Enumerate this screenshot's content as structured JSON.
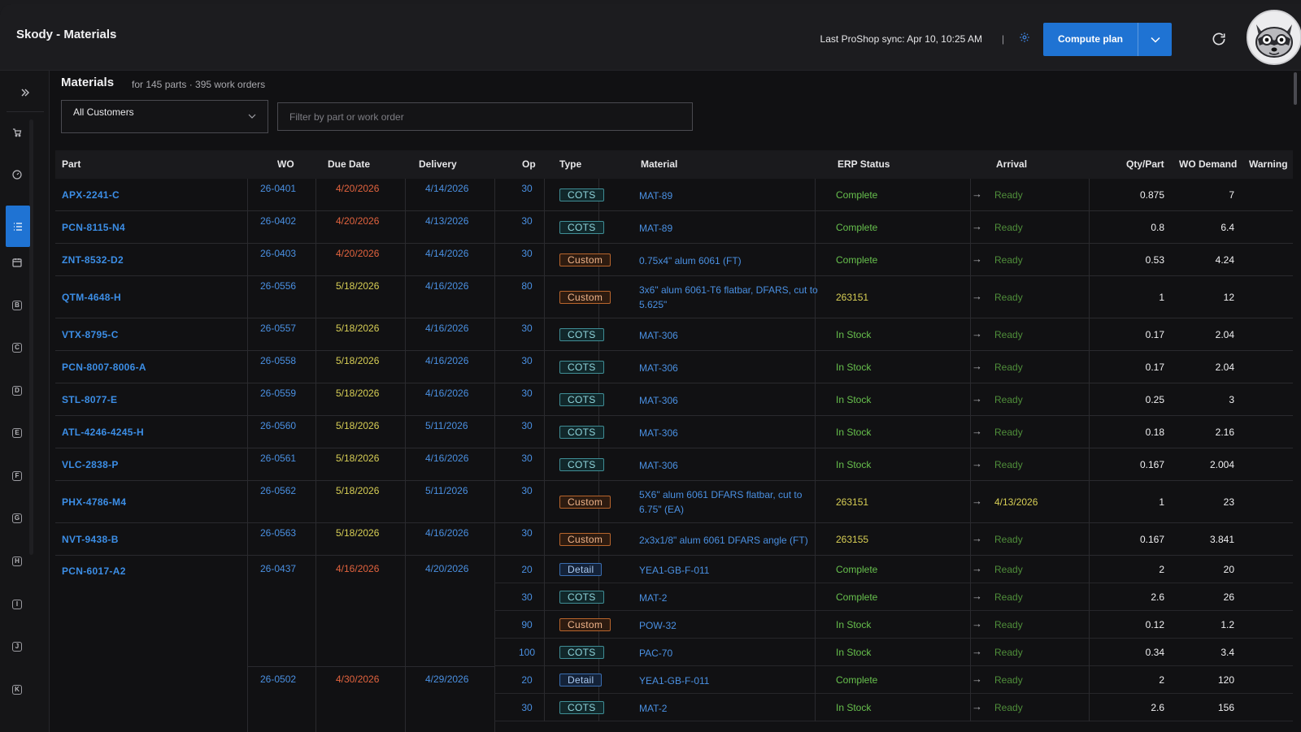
{
  "app": {
    "title": "Skody - Materials",
    "sync_text": "Last ProShop sync: Apr 10, 10:25 AM",
    "sync_sep": "|",
    "compute_label": "Compute plan"
  },
  "icons": {
    "settings": "gear-icon",
    "refresh": "refresh-icon",
    "avatar": "raccoon-avatar",
    "expand": "double-chevron-right-icon"
  },
  "rail": {
    "letters": [
      "B",
      "C",
      "D",
      "E",
      "F",
      "G",
      "H",
      "I",
      "J",
      "K"
    ]
  },
  "page": {
    "title": "Materials",
    "subtitle": "for 145 parts · 395 work orders",
    "customer_select": "All Customers",
    "filter_placeholder": "Filter by part or work order"
  },
  "columns": {
    "part": "Part",
    "wo": "WO",
    "due": "Due Date",
    "delivery": "Delivery",
    "op": "Op",
    "type": "Type",
    "material": "Material",
    "erp": "ERP Status",
    "arrival": "Arrival",
    "qty": "Qty/Part",
    "demand": "WO Demand",
    "warning": "Warning"
  },
  "rows": [
    {
      "part": "APX-2241-C",
      "wo": "26-0401",
      "due": "4/20/2026",
      "delivery": "4/14/2026",
      "op": "30",
      "type": "COTS",
      "material": "MAT-89",
      "erp": "Complete",
      "arrival": "Ready",
      "qty": "0.875",
      "demand": "7"
    },
    {
      "part": "PCN-8115-N4",
      "wo": "26-0402",
      "due": "4/20/2026",
      "delivery": "4/13/2026",
      "op": "30",
      "type": "COTS",
      "material": "MAT-89",
      "erp": "Complete",
      "arrival": "Ready",
      "qty": "0.8",
      "demand": "6.4"
    },
    {
      "part": "ZNT-8532-D2",
      "wo": "26-0403",
      "due": "4/20/2026",
      "delivery": "4/14/2026",
      "op": "30",
      "type": "Custom",
      "material": "0.75x4\" alum 6061 (FT)",
      "erp": "Complete",
      "arrival": "Ready",
      "qty": "0.53",
      "demand": "4.24"
    },
    {
      "part": "QTM-4648-H",
      "wo": "26-0556",
      "due": "5/18/2026",
      "delivery": "4/16/2026",
      "op": "80",
      "type": "Custom",
      "material": "3x6\" alum 6061-T6 flatbar, DFARS, cut to 5.625\"",
      "erp": "263151",
      "arrival": "Ready",
      "qty": "1",
      "demand": "12"
    },
    {
      "part": "VTX-8795-C",
      "wo": "26-0557",
      "due": "5/18/2026",
      "delivery": "4/16/2026",
      "op": "30",
      "type": "COTS",
      "material": "MAT-306",
      "erp": "In Stock",
      "arrival": "Ready",
      "qty": "0.17",
      "demand": "2.04"
    },
    {
      "part": "PCN-8007-8006-A",
      "wo": "26-0558",
      "due": "5/18/2026",
      "delivery": "4/16/2026",
      "op": "30",
      "type": "COTS",
      "material": "MAT-306",
      "erp": "In Stock",
      "arrival": "Ready",
      "qty": "0.17",
      "demand": "2.04"
    },
    {
      "part": "STL-8077-E",
      "wo": "26-0559",
      "due": "5/18/2026",
      "delivery": "4/16/2026",
      "op": "30",
      "type": "COTS",
      "material": "MAT-306",
      "erp": "In Stock",
      "arrival": "Ready",
      "qty": "0.25",
      "demand": "3"
    },
    {
      "part": "ATL-4246-4245-H",
      "wo": "26-0560",
      "due": "5/18/2026",
      "delivery": "5/11/2026",
      "op": "30",
      "type": "COTS",
      "material": "MAT-306",
      "erp": "In Stock",
      "arrival": "Ready",
      "qty": "0.18",
      "demand": "2.16"
    },
    {
      "part": "VLC-2838-P",
      "wo": "26-0561",
      "due": "5/18/2026",
      "delivery": "4/16/2026",
      "op": "30",
      "type": "COTS",
      "material": "MAT-306",
      "erp": "In Stock",
      "arrival": "Ready",
      "qty": "0.167",
      "demand": "2.004"
    },
    {
      "part": "PHX-4786-M4",
      "wo": "26-0562",
      "due": "5/18/2026",
      "delivery": "5/11/2026",
      "op": "30",
      "type": "Custom",
      "material": "5X6\" alum 6061 DFARS flatbar, cut to 6.75\" (EA)",
      "erp": "263151",
      "arrival": "4/13/2026",
      "qty": "1",
      "demand": "23"
    },
    {
      "part": "NVT-9438-B",
      "wo": "26-0563",
      "due": "5/18/2026",
      "delivery": "4/16/2026",
      "op": "30",
      "type": "Custom",
      "material": "2x3x1/8\" alum 6061 DFARS angle (FT)",
      "erp": "263155",
      "arrival": "Ready",
      "qty": "0.167",
      "demand": "3.841"
    }
  ],
  "group": {
    "part": "PCN-6017-A2",
    "work_orders": [
      {
        "wo": "26-0437",
        "due": "4/16/2026",
        "delivery": "4/20/2026",
        "ops": [
          {
            "op": "20",
            "type": "Detail",
            "material": "YEA1-GB-F-011",
            "erp": "Complete",
            "arrival": "Ready",
            "qty": "2",
            "demand": "20"
          },
          {
            "op": "30",
            "type": "COTS",
            "material": "MAT-2",
            "erp": "Complete",
            "arrival": "Ready",
            "qty": "2.6",
            "demand": "26"
          },
          {
            "op": "90",
            "type": "Custom",
            "material": "POW-32",
            "erp": "In Stock",
            "arrival": "Ready",
            "qty": "0.12",
            "demand": "1.2"
          },
          {
            "op": "100",
            "type": "COTS",
            "material": "PAC-70",
            "erp": "In Stock",
            "arrival": "Ready",
            "qty": "0.34",
            "demand": "3.4"
          }
        ]
      },
      {
        "wo": "26-0502",
        "due": "4/30/2026",
        "delivery": "4/29/2026",
        "ops": [
          {
            "op": "20",
            "type": "Detail",
            "material": "YEA1-GB-F-011",
            "erp": "Complete",
            "arrival": "Ready",
            "qty": "2",
            "demand": "120"
          },
          {
            "op": "30",
            "type": "COTS",
            "material": "MAT-2",
            "erp": "In Stock",
            "arrival": "Ready",
            "qty": "2.6",
            "demand": "156"
          }
        ]
      }
    ]
  }
}
